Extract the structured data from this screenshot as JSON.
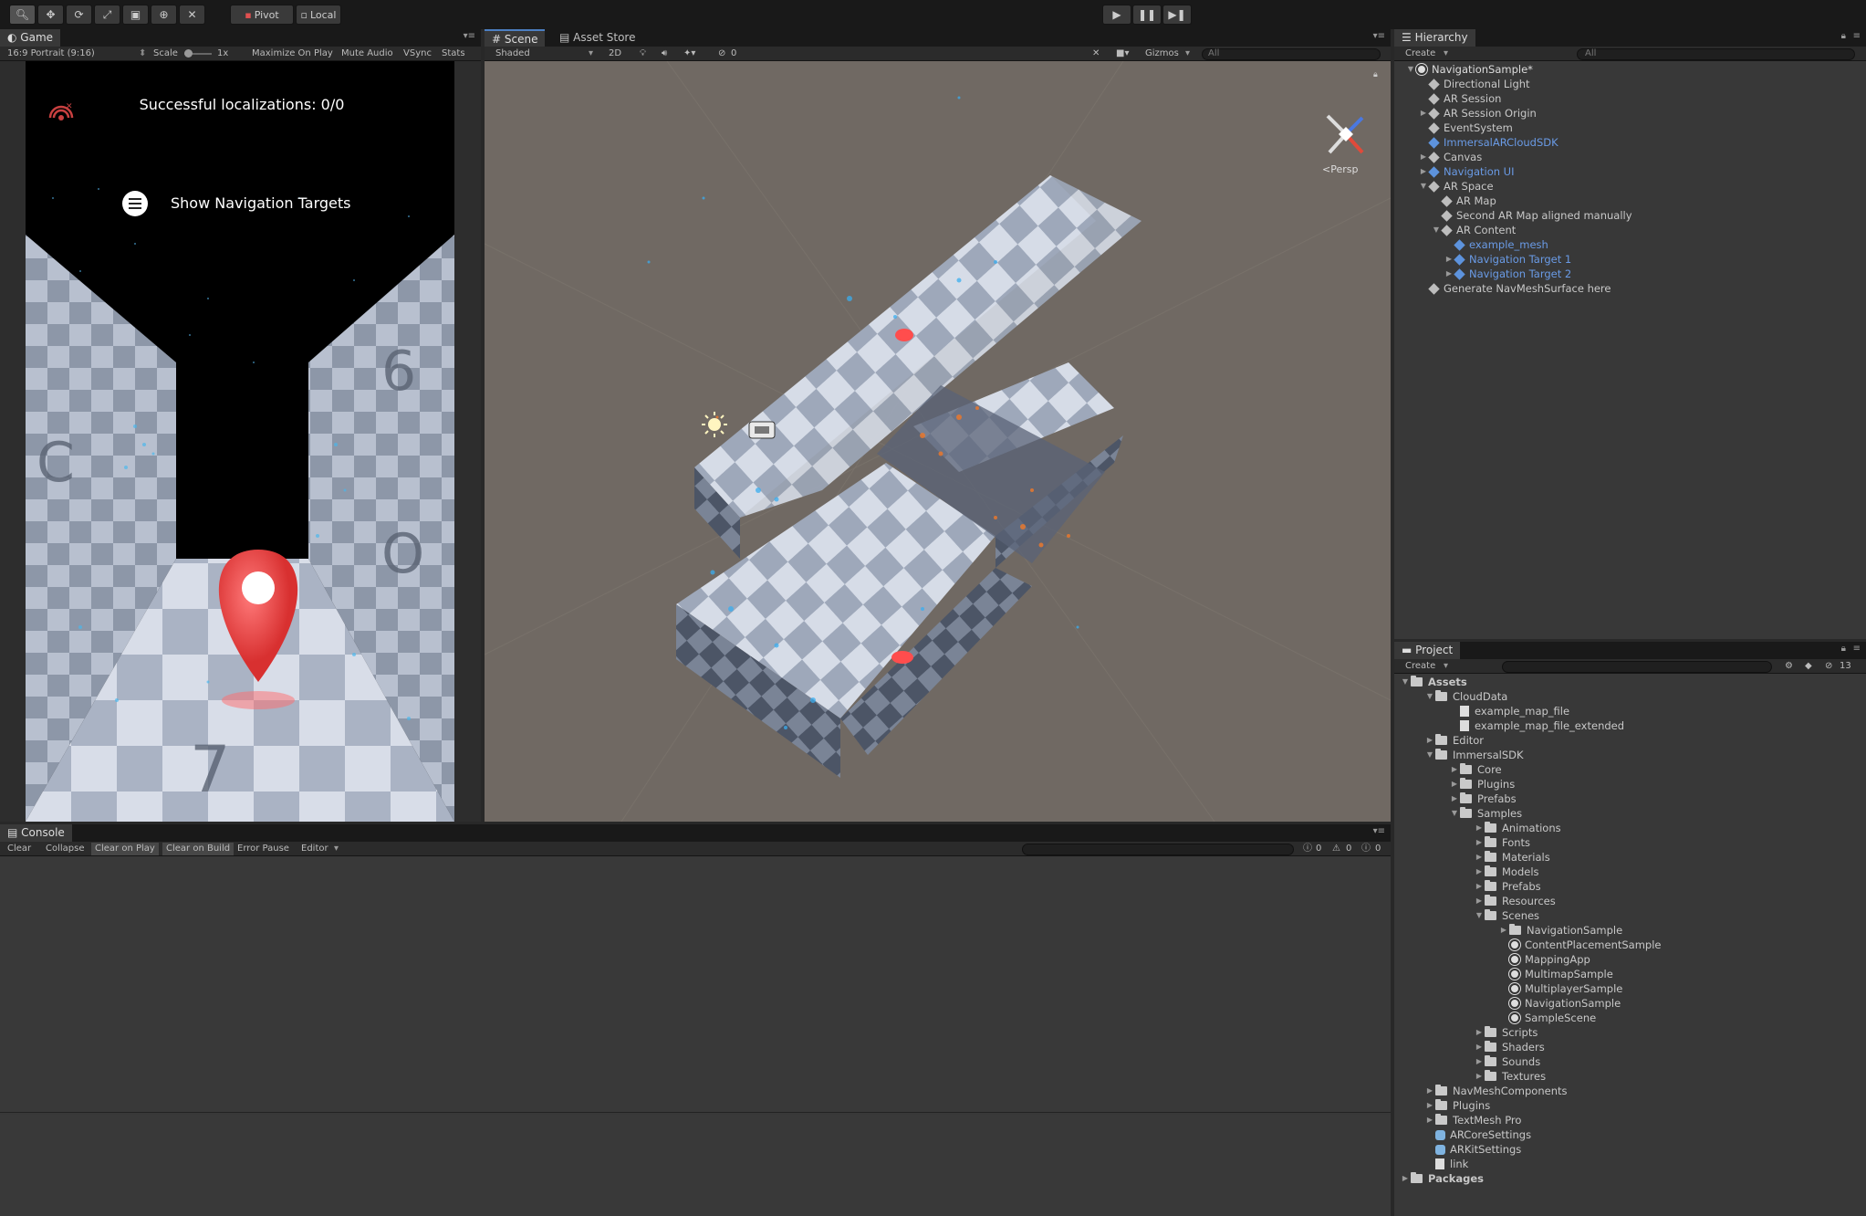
{
  "toolbar": {
    "pivot_label": "Pivot",
    "local_label": "Local"
  },
  "game": {
    "tab_label": "Game",
    "aspect_label": "16:9 Portrait (9:16)",
    "scale_label": "Scale",
    "scale_value": "1x",
    "maximize_label": "Maximize On Play",
    "mute_label": "Mute Audio",
    "vsync_label": "VSync",
    "stats_label": "Stats",
    "localizations_text": "Successful localizations: 0/0",
    "show_targets_text": "Show Navigation Targets"
  },
  "scene": {
    "tab_label": "Scene",
    "asset_store_tab_label": "Asset Store",
    "shading_mode": "Shaded",
    "mode_2d_label": "2D",
    "hidden_count": "0",
    "gizmos_label": "Gizmos",
    "search_placeholder": "All",
    "persp_label": "Persp"
  },
  "hierarchy": {
    "tab_label": "Hierarchy",
    "create_label": "Create",
    "search_placeholder": "All",
    "items": [
      {
        "label": "NavigationSample*",
        "indent": 0,
        "arrow": "▼",
        "type": "scene",
        "color": "#dddddd"
      },
      {
        "label": "Directional Light",
        "indent": 1,
        "arrow": "",
        "type": "go",
        "color": "#c8c8c8"
      },
      {
        "label": "AR Session",
        "indent": 1,
        "arrow": "",
        "type": "go",
        "color": "#c8c8c8"
      },
      {
        "label": "AR Session Origin",
        "indent": 1,
        "arrow": "▶",
        "type": "go",
        "color": "#c8c8c8"
      },
      {
        "label": "EventSystem",
        "indent": 1,
        "arrow": "",
        "type": "go",
        "color": "#c8c8c8"
      },
      {
        "label": "ImmersalARCloudSDK",
        "indent": 1,
        "arrow": "",
        "type": "prefab",
        "color": "#6a9be6"
      },
      {
        "label": "Canvas",
        "indent": 1,
        "arrow": "▶",
        "type": "go",
        "color": "#c8c8c8"
      },
      {
        "label": "Navigation UI",
        "indent": 1,
        "arrow": "▶",
        "type": "prefab",
        "color": "#6a9be6"
      },
      {
        "label": "AR Space",
        "indent": 1,
        "arrow": "▼",
        "type": "go",
        "color": "#c8c8c8"
      },
      {
        "label": "AR Map",
        "indent": 2,
        "arrow": "",
        "type": "go",
        "color": "#c8c8c8"
      },
      {
        "label": "Second AR Map aligned manually",
        "indent": 2,
        "arrow": "",
        "type": "go",
        "color": "#c8c8c8"
      },
      {
        "label": "AR Content",
        "indent": 2,
        "arrow": "▼",
        "type": "go",
        "color": "#c8c8c8"
      },
      {
        "label": "example_mesh",
        "indent": 3,
        "arrow": "",
        "type": "prefab",
        "color": "#6a9be6"
      },
      {
        "label": "Navigation Target 1",
        "indent": 3,
        "arrow": "▶",
        "type": "prefab",
        "color": "#6a9be6"
      },
      {
        "label": "Navigation Target 2",
        "indent": 3,
        "arrow": "▶",
        "type": "prefab",
        "color": "#6a9be6"
      },
      {
        "label": "Generate NavMeshSurface here",
        "indent": 1,
        "arrow": "",
        "type": "go",
        "color": "#c8c8c8"
      }
    ]
  },
  "project": {
    "tab_label": "Project",
    "create_label": "Create",
    "hidden_count": "13",
    "items": [
      {
        "label": "Assets",
        "indent": 0,
        "arrow": "▼",
        "type": "folder",
        "bold": true
      },
      {
        "label": "CloudData",
        "indent": 1,
        "arrow": "▼",
        "type": "folder"
      },
      {
        "label": "example_map_file",
        "indent": 2,
        "arrow": "",
        "type": "file"
      },
      {
        "label": "example_map_file_extended",
        "indent": 2,
        "arrow": "",
        "type": "file"
      },
      {
        "label": "Editor",
        "indent": 1,
        "arrow": "▶",
        "type": "folder"
      },
      {
        "label": "ImmersalSDK",
        "indent": 1,
        "arrow": "▼",
        "type": "folder"
      },
      {
        "label": "Core",
        "indent": 2,
        "arrow": "▶",
        "type": "folder"
      },
      {
        "label": "Plugins",
        "indent": 2,
        "arrow": "▶",
        "type": "folder"
      },
      {
        "label": "Prefabs",
        "indent": 2,
        "arrow": "▶",
        "type": "folder"
      },
      {
        "label": "Samples",
        "indent": 2,
        "arrow": "▼",
        "type": "folder"
      },
      {
        "label": "Animations",
        "indent": 3,
        "arrow": "▶",
        "type": "folder"
      },
      {
        "label": "Fonts",
        "indent": 3,
        "arrow": "▶",
        "type": "folder"
      },
      {
        "label": "Materials",
        "indent": 3,
        "arrow": "▶",
        "type": "folder"
      },
      {
        "label": "Models",
        "indent": 3,
        "arrow": "▶",
        "type": "folder"
      },
      {
        "label": "Prefabs",
        "indent": 3,
        "arrow": "▶",
        "type": "folder"
      },
      {
        "label": "Resources",
        "indent": 3,
        "arrow": "▶",
        "type": "folder"
      },
      {
        "label": "Scenes",
        "indent": 3,
        "arrow": "▼",
        "type": "folder"
      },
      {
        "label": "NavigationSample",
        "indent": 4,
        "arrow": "▶",
        "type": "folder"
      },
      {
        "label": "ContentPlacementSample",
        "indent": 4,
        "arrow": "",
        "type": "scene"
      },
      {
        "label": "MappingApp",
        "indent": 4,
        "arrow": "",
        "type": "scene"
      },
      {
        "label": "MultimapSample",
        "indent": 4,
        "arrow": "",
        "type": "scene"
      },
      {
        "label": "MultiplayerSample",
        "indent": 4,
        "arrow": "",
        "type": "scene"
      },
      {
        "label": "NavigationSample",
        "indent": 4,
        "arrow": "",
        "type": "scene"
      },
      {
        "label": "SampleScene",
        "indent": 4,
        "arrow": "",
        "type": "scene"
      },
      {
        "label": "Scripts",
        "indent": 3,
        "arrow": "▶",
        "type": "folder"
      },
      {
        "label": "Shaders",
        "indent": 3,
        "arrow": "▶",
        "type": "folder"
      },
      {
        "label": "Sounds",
        "indent": 3,
        "arrow": "▶",
        "type": "folder"
      },
      {
        "label": "Textures",
        "indent": 3,
        "arrow": "▶",
        "type": "folder"
      },
      {
        "label": "NavMeshComponents",
        "indent": 1,
        "arrow": "▶",
        "type": "folder"
      },
      {
        "label": "Plugins",
        "indent": 1,
        "arrow": "▶",
        "type": "folder"
      },
      {
        "label": "TextMesh Pro",
        "indent": 1,
        "arrow": "▶",
        "type": "folder"
      },
      {
        "label": "ARCoreSettings",
        "indent": 1,
        "arrow": "",
        "type": "asset"
      },
      {
        "label": "ARKitSettings",
        "indent": 1,
        "arrow": "",
        "type": "asset"
      },
      {
        "label": "link",
        "indent": 1,
        "arrow": "",
        "type": "file"
      },
      {
        "label": "Packages",
        "indent": 0,
        "arrow": "▶",
        "type": "folder",
        "bold": true
      }
    ]
  },
  "console": {
    "tab_label": "Console",
    "clear_label": "Clear",
    "collapse_label": "Collapse",
    "clear_on_play_label": "Clear on Play",
    "clear_on_build_label": "Clear on Build",
    "error_pause_label": "Error Pause",
    "editor_label": "Editor",
    "log_count": "0",
    "warning_count": "0",
    "error_count": "0"
  }
}
